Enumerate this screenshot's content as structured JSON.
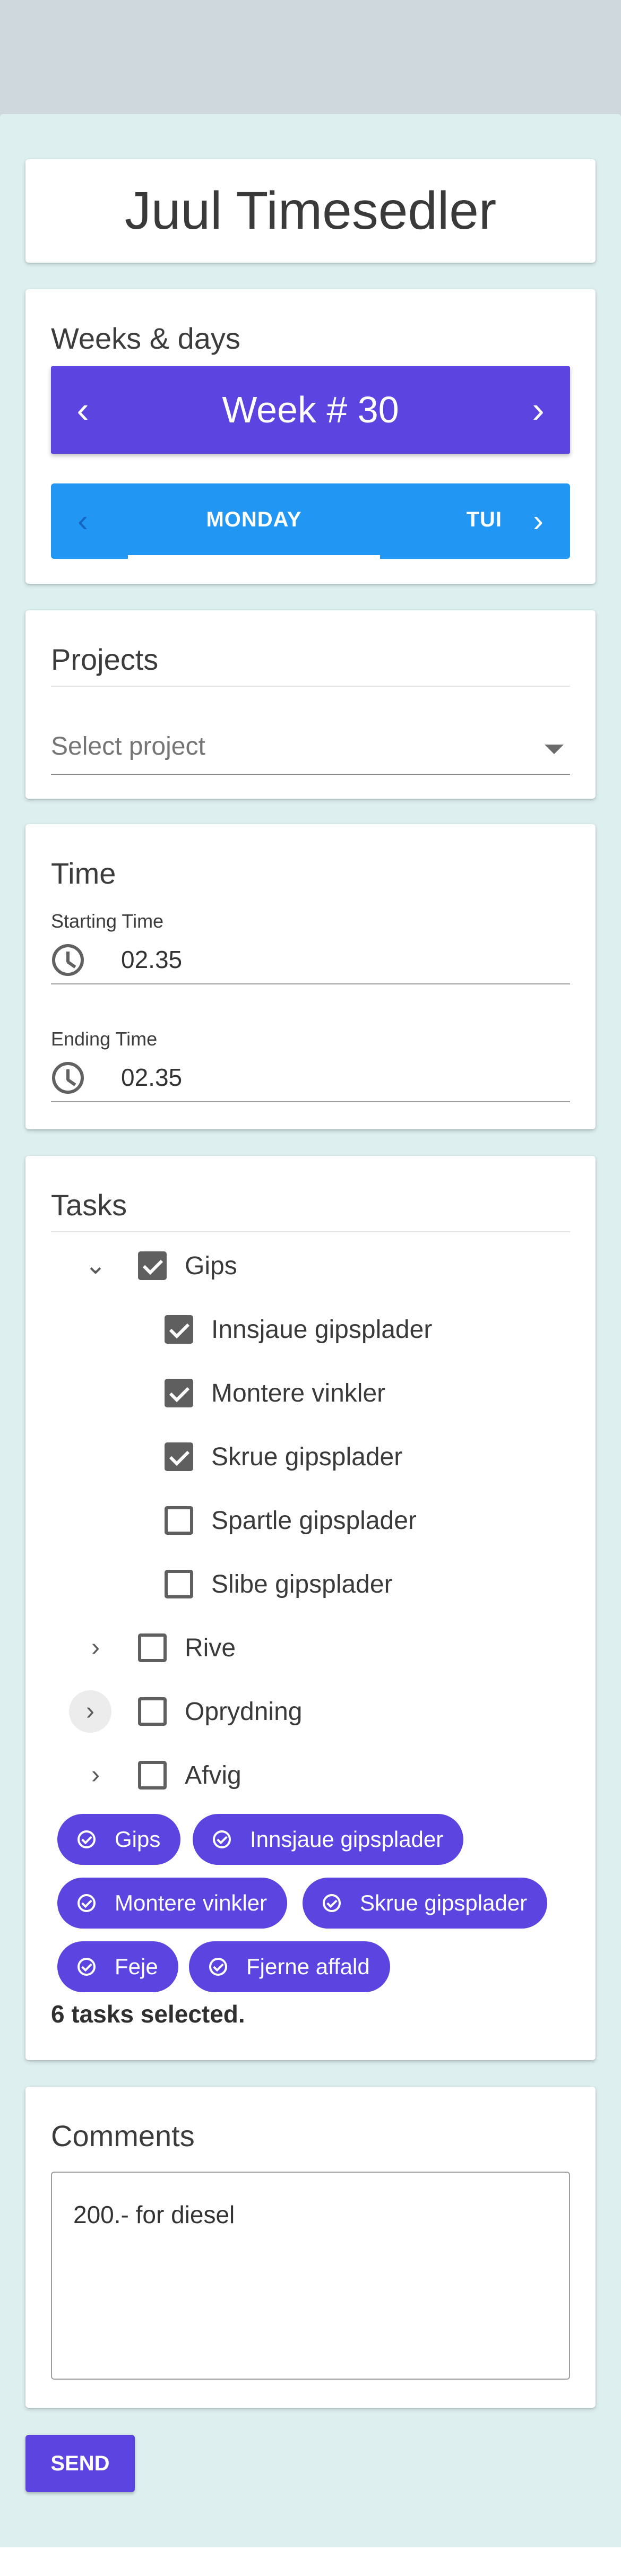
{
  "app": {
    "title": "Juul Timesedler"
  },
  "weeks": {
    "section_title": "Weeks & days",
    "week_label": "Week # 30",
    "prev_icon": "chevron-left-icon",
    "next_icon": "chevron-right-icon",
    "tabs": {
      "active": "MONDAY",
      "next": "TUI"
    }
  },
  "projects": {
    "section_title": "Projects",
    "select_placeholder": "Select project"
  },
  "time": {
    "section_title": "Time",
    "start_label": "Starting Time",
    "start_value": "02.35",
    "end_label": "Ending Time",
    "end_value": "02.35"
  },
  "tasks": {
    "section_title": "Tasks",
    "tree": [
      {
        "label": "Gips",
        "checked": true,
        "expanded": true
      },
      {
        "label": "Innsjaue gipsplader",
        "checked": true
      },
      {
        "label": "Montere vinkler",
        "checked": true
      },
      {
        "label": "Skrue gipsplader",
        "checked": true
      },
      {
        "label": "Spartle gipsplader",
        "checked": false
      },
      {
        "label": "Slibe gipsplader",
        "checked": false
      },
      {
        "label": "Rive",
        "checked": false,
        "expanded": false
      },
      {
        "label": "Oprydning",
        "checked": false,
        "expanded": false
      },
      {
        "label": "Afvig",
        "checked": false,
        "expanded": false
      }
    ],
    "chips": [
      "Gips",
      "Innsjaue gipsplader",
      "Montere vinkler",
      "Skrue gipsplader",
      "Feje",
      "Fjerne affald"
    ],
    "selected_count_text": "6 tasks selected."
  },
  "comments": {
    "section_title": "Comments",
    "value": "200.- for diesel"
  },
  "send_label": "SEND",
  "colors": {
    "primary": "#5b44e0",
    "tabs_blue": "#2196f3",
    "page_background": "#ddf0ef",
    "header_band": "#cfd8dc"
  }
}
